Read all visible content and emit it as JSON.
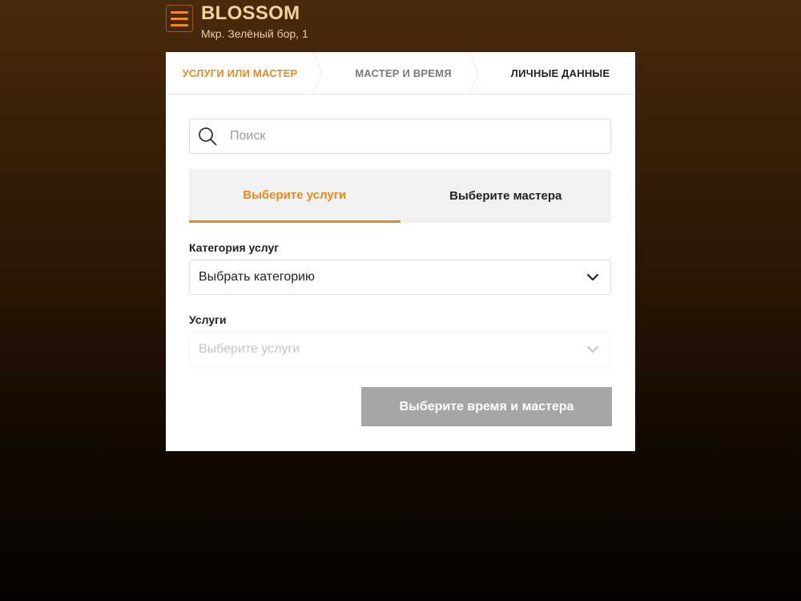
{
  "header": {
    "brand_name": "BLOSSOM",
    "address": "Мкр. Зелёный бор, 1"
  },
  "steps": [
    {
      "label": "Услуги или мастер",
      "state": "active"
    },
    {
      "label": "Мастер и время",
      "state": "inactive"
    },
    {
      "label": "Личные данные",
      "state": "inactive"
    }
  ],
  "search": {
    "placeholder": "Поиск",
    "value": ""
  },
  "tabs": [
    {
      "label": "Выберите услуги",
      "active": true
    },
    {
      "label": "Выберите мастера",
      "active": false
    }
  ],
  "category": {
    "label": "Категория услуг",
    "selected": "Выбрать категорию"
  },
  "services": {
    "label": "Услуги",
    "selected": "Выберите услуги",
    "disabled": true
  },
  "submit_button": {
    "label": "Выберите время и мастера",
    "disabled": true
  },
  "colors": {
    "accent": "#e28a1c",
    "brand_text": "#f3d39a",
    "disabled_button": "#a6a6a6"
  },
  "icons": {
    "menu": "hamburger-icon",
    "search": "search-icon",
    "dropdown": "chevron-down-icon",
    "step_separator": "chevron-right-icon"
  }
}
